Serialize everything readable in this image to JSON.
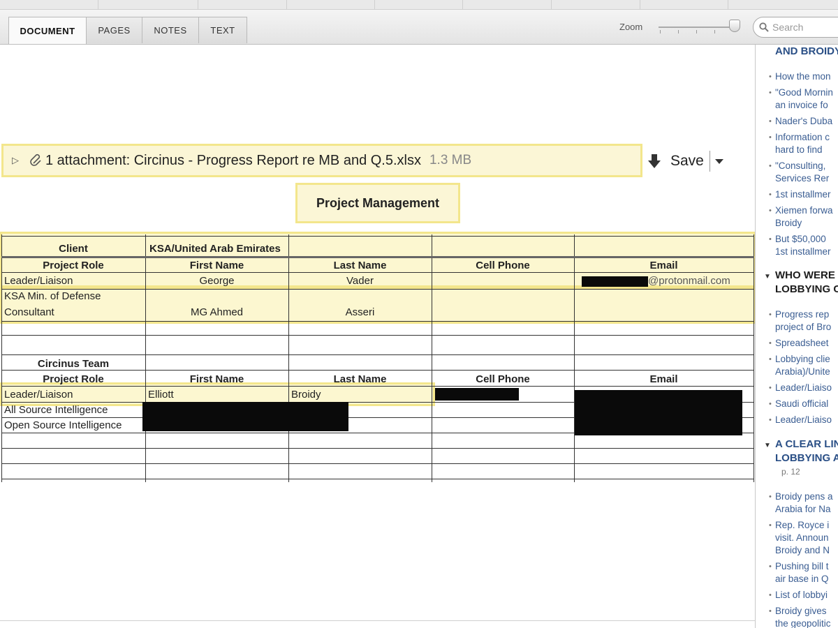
{
  "toolbar": {
    "tabs": [
      {
        "label": "DOCUMENT",
        "active": true
      },
      {
        "label": "PAGES",
        "active": false
      },
      {
        "label": "NOTES",
        "active": false
      },
      {
        "label": "TEXT",
        "active": false
      }
    ],
    "zoom_label": "Zoom",
    "search_placeholder": "Search"
  },
  "document": {
    "attachment": {
      "text": "1 attachment: Circinus - Progress Report re MB and Q.5.xlsx",
      "size": "1.3 MB",
      "save_label": "Save"
    },
    "project_title": "Project Management",
    "client_table": {
      "client_label": "Client",
      "client_value": "KSA/United Arab Emirates",
      "headers": [
        "Project Role",
        "First Name",
        "Last Name",
        "Cell Phone",
        "Email"
      ],
      "rows": [
        {
          "role": "Leader/Liaison",
          "first": "George",
          "last": "Vader",
          "phone": "",
          "email": "@protonmail.com"
        },
        {
          "role_line1": "KSA Min. of Defense",
          "role_line2": "Consultant",
          "first": "MG Ahmed",
          "last": "Asseri",
          "phone": "",
          "email": ""
        }
      ]
    },
    "team_table": {
      "team_label": "Circinus Team",
      "headers": [
        "Project Role",
        "First Name",
        "Last Name",
        "Cell Phone",
        "Email"
      ],
      "rows": [
        {
          "role": "Leader/Liaison",
          "first": "Elliott",
          "last": "Broidy"
        },
        {
          "role": "All Source Intelligence"
        },
        {
          "role": "Open Source Intelligence"
        }
      ]
    }
  },
  "sidebar": {
    "sections": [
      {
        "heading": "AND BROIDY",
        "items": [
          [
            "How the mon"
          ],
          [
            "\"Good Mornin",
            "an invoice fo"
          ],
          [
            "Nader's Duba"
          ],
          [
            "Information c",
            "hard to find"
          ],
          [
            "\"Consulting,",
            "Services Rer"
          ],
          [
            "1st installmer"
          ],
          [
            "Xiemen forwa",
            "Broidy"
          ],
          [
            "But $50,000",
            "1st installmer"
          ]
        ]
      },
      {
        "heading_line1": "WHO WERE",
        "heading_line2": "LOBBYING C",
        "items": [
          [
            "Progress rep",
            "project of Bro"
          ],
          [
            "Spreadsheet"
          ],
          [
            "Lobbying clie",
            "Arabia)/Unite"
          ],
          [
            "Leader/Liaiso"
          ],
          [
            "Saudi official"
          ],
          [
            "Leader/Liaiso"
          ]
        ]
      },
      {
        "heading_line1": "A CLEAR LIN",
        "heading_line2": "LOBBYING A",
        "page": "p. 12",
        "items": [
          [
            "Broidy pens a",
            "Arabia for Na"
          ],
          [
            "Rep. Royce i",
            "visit. Announ",
            "Broidy and N"
          ],
          [
            "Pushing bill t",
            "air base in Q"
          ],
          [
            "List of lobbyi"
          ],
          [
            "Broidy gives",
            "the geopolitic"
          ]
        ]
      }
    ]
  }
}
